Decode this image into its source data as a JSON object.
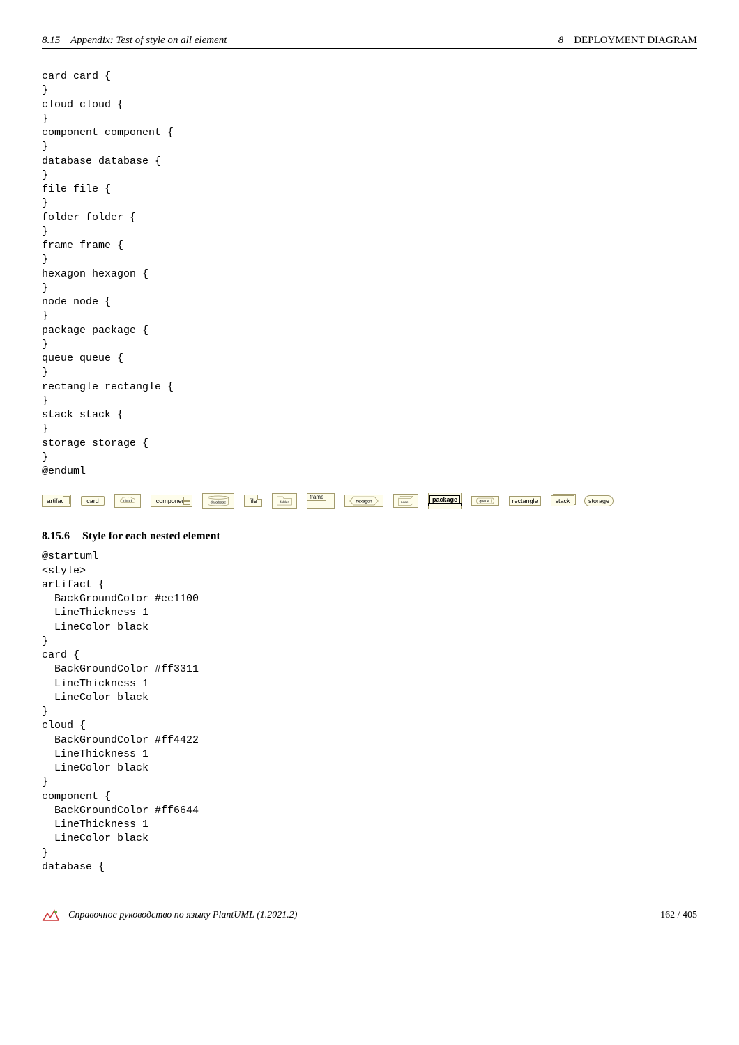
{
  "header": {
    "left_section": "8.15",
    "left_title": "Appendix: Test of style on all element",
    "right_num": "8",
    "right_title": "DEPLOYMENT DIAGRAM"
  },
  "code1": "card card {\n}\ncloud cloud {\n}\ncomponent component {\n}\ndatabase database {\n}\nfile file {\n}\nfolder folder {\n}\nframe frame {\n}\nhexagon hexagon {\n}\nnode node {\n}\npackage package {\n}\nqueue queue {\n}\nrectangle rectangle {\n}\nstack stack {\n}\nstorage storage {\n}\n@enduml",
  "shapes": {
    "artifact": "artifact",
    "card": "card",
    "cloud": "cloud",
    "component": "component",
    "database": "database",
    "file": "file",
    "folder": "folder",
    "frame": "frame",
    "hexagon": "hexagon",
    "node": "node",
    "package": "package",
    "queue": "queue",
    "rectangle": "rectangle",
    "stack": "stack",
    "storage": "storage"
  },
  "subsection": {
    "num": "8.15.6",
    "title": "Style for each nested element"
  },
  "code2": "@startuml\n<style>\nartifact {\n  BackGroundColor #ee1100\n  LineThickness 1\n  LineColor black\n}\ncard {\n  BackGroundColor #ff3311\n  LineThickness 1\n  LineColor black\n}\ncloud {\n  BackGroundColor #ff4422\n  LineThickness 1\n  LineColor black\n}\ncomponent {\n  BackGroundColor #ff6644\n  LineThickness 1\n  LineColor black\n}\ndatabase {",
  "footer": {
    "text": "Справочное руководство по языку PlantUML (1.2021.2)",
    "page": "162 / 405"
  }
}
